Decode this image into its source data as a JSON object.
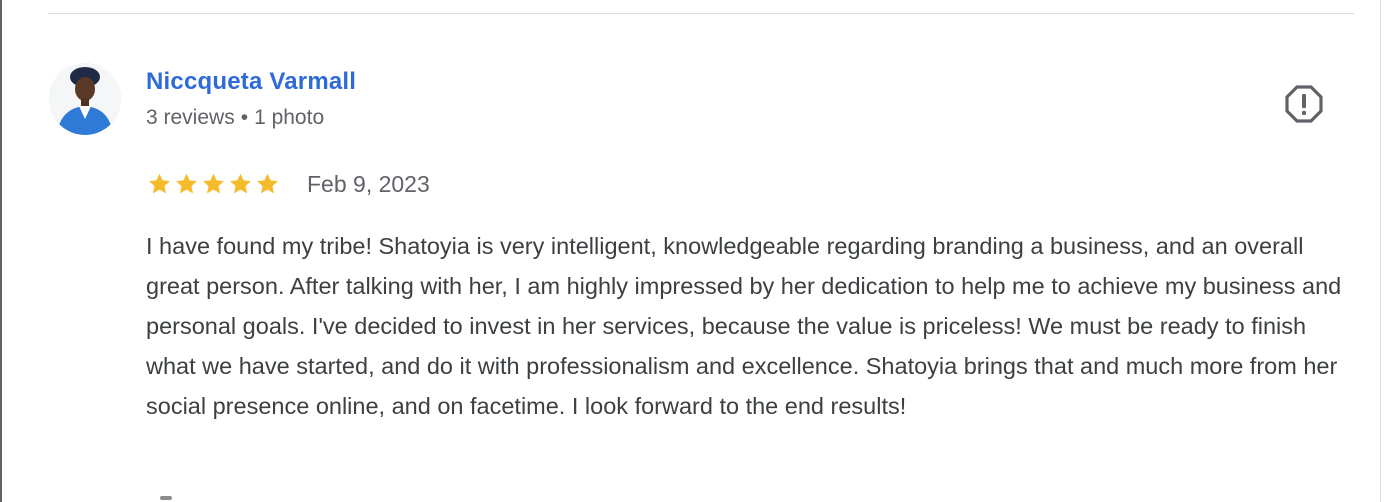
{
  "review": {
    "author_name": "Niccqueta Varmall",
    "reviews_count": "3 reviews",
    "separator": "•",
    "photos_count": "1 photo",
    "rating": 5,
    "rating_max": 5,
    "date": "Feb 9, 2023",
    "text": "I have found my tribe! Shatoyia is very intelligent, knowledgeable regarding branding a business, and an overall great person. After talking with her, I am highly impressed by her dedication to help me to achieve my business and personal goals. I've decided to invest in her services, because the value is priceless! We must be ready to finish what we have started, and do it with professionalism and excellence. Shatoyia brings that and much more from her social presence online, and on facetime. I look forward to the end results!",
    "report_icon": "report-flag-icon",
    "avatar_icon": "user-avatar"
  },
  "colors": {
    "author_link": "#2f6ad9",
    "star": "#f6bb2c",
    "secondary_text": "#5f6368",
    "body_text": "#3c4043",
    "divider": "#dadce0"
  }
}
